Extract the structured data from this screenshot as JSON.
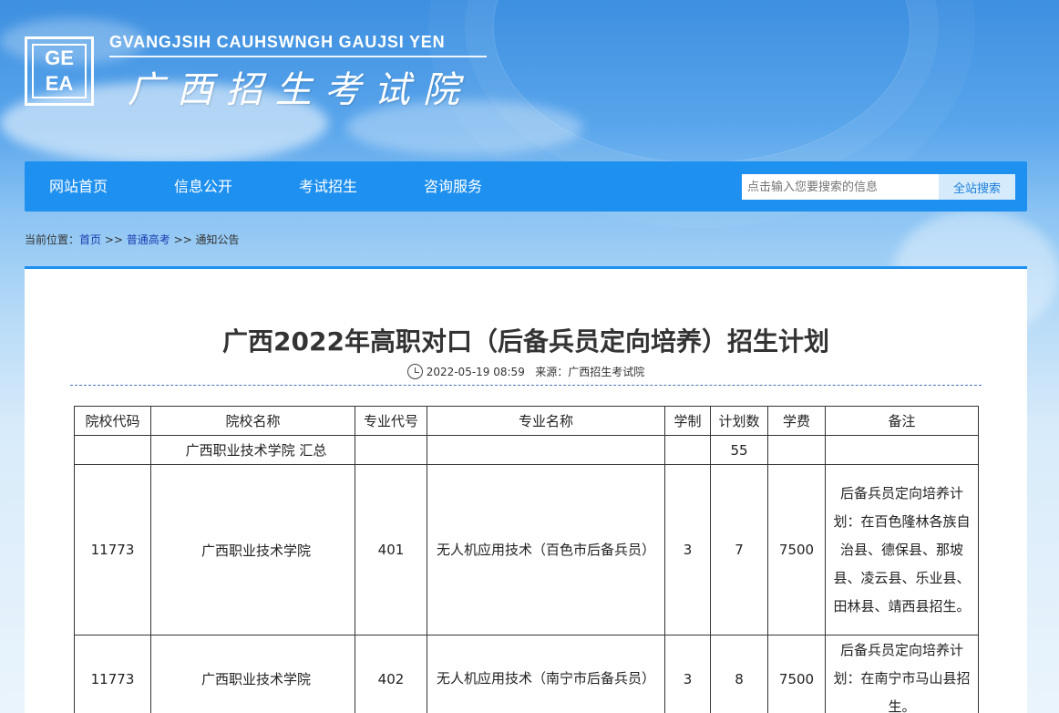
{
  "header": {
    "logo_letters": [
      "GE",
      "EA"
    ],
    "site_latin": "GVANGJSIH CAUHSWNGH GAUJSI YEN",
    "site_name": "广西招生考试院"
  },
  "nav": {
    "items": [
      "网站首页",
      "信息公开",
      "考试招生",
      "咨询服务"
    ],
    "search_placeholder": "点击输入您要搜索的信息",
    "search_button": "全站搜索"
  },
  "breadcrumb": {
    "prefix": "当前位置：",
    "items": [
      "首页",
      "普通高考",
      "通知公告"
    ],
    "separator": " >> "
  },
  "article": {
    "title": "广西2022年高职对口（后备兵员定向培养）招生计划",
    "date": "2022-05-19 08:59",
    "source_label": "来源：",
    "source": "广西招生考试院"
  },
  "table": {
    "headers": [
      "院校代码",
      "院校名称",
      "专业代号",
      "专业名称",
      "学制",
      "计划数",
      "学费",
      "备注"
    ],
    "summary": {
      "code": "",
      "school": "广西职业技术学院 汇总",
      "major_code": "",
      "major": "",
      "years": "",
      "plan": "55",
      "fee": "",
      "note": ""
    },
    "rows": [
      {
        "code": "11773",
        "school": "广西职业技术学院",
        "major_code": "401",
        "major": "无人机应用技术（百色市后备兵员）",
        "years": "3",
        "plan": "7",
        "fee": "7500",
        "note": "后备兵员定向培养计划：在百色隆林各族自治县、德保县、那坡县、凌云县、乐业县、田林县、靖西县招生。"
      },
      {
        "code": "11773",
        "school": "广西职业技术学院",
        "major_code": "402",
        "major": "无人机应用技术（南宁市后备兵员）",
        "years": "3",
        "plan": "8",
        "fee": "7500",
        "note": "后备兵员定向培养计划：在南宁市马山县招生。"
      }
    ]
  }
}
